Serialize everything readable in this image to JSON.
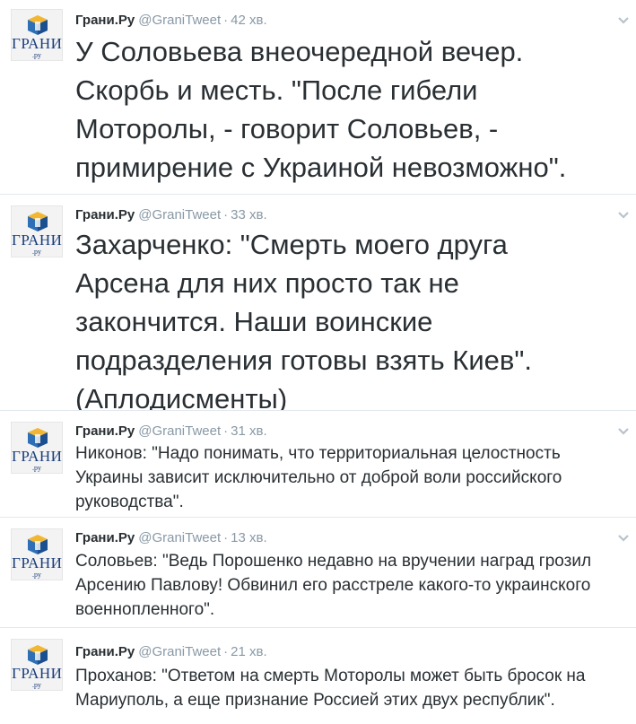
{
  "tweets": [
    {
      "author_name": "Грани.Ру",
      "author_handle": "@GraniTweet",
      "separator": "·",
      "time": "42 хв.",
      "avatar_text": "ГРАНИ",
      "avatar_sub": ".ру",
      "text": "У Соловьева внеочередной вечер.\nСкорбь и месть. \"После гибели\nМоторолы, - говорит Соловьев, -\nпримирение с Украиной невозможно\"."
    },
    {
      "author_name": "Грани.Ру",
      "author_handle": "@GraniTweet",
      "separator": "·",
      "time": "33 хв.",
      "avatar_text": "ГРАНИ",
      "avatar_sub": ".ру",
      "text": "Захарченко: \"Смерть моего друга\nАрсена для них просто так не\nзакончится. Наши воинские\nподразделения готовы взять Киев\".\n(Аплодисменты)"
    },
    {
      "author_name": "Грани.Ру",
      "author_handle": "@GraniTweet",
      "separator": "·",
      "time": "31 хв.",
      "avatar_text": "ГРАНИ",
      "avatar_sub": ".ру",
      "text": "Никонов: \"Надо понимать, что территориальная целостность\nУкраины зависит исключительно от доброй воли российского\nруководства\"."
    },
    {
      "author_name": "Грани.Ру",
      "author_handle": "@GraniTweet",
      "separator": "·",
      "time": "13 хв.",
      "avatar_text": "ГРАНИ",
      "avatar_sub": ".ру",
      "text": "Соловьев: \"Ведь Порошенко недавно на вручении наград грозил\nАрсению Павлову! Обвинил его расстреле какого-то украинского\nвоеннопленного\"."
    },
    {
      "author_name": "Грани.Ру",
      "author_handle": "@GraniTweet",
      "separator": "·",
      "time": "21 хв.",
      "avatar_text": "ГРАНИ",
      "avatar_sub": ".ру",
      "text": "Проханов: \"Ответом на смерть Моторолы может быть бросок на\nМариуполь, а еще признание Россией этих двух республик\"."
    }
  ],
  "colors": {
    "name": "#292f33",
    "meta": "#8899a6",
    "divider": "#e1e8ed",
    "avatar_brand": "#1a3d7c"
  },
  "icons": {
    "avatar_cube": "grani-logo-cube",
    "menu": "chevron-down-icon"
  }
}
